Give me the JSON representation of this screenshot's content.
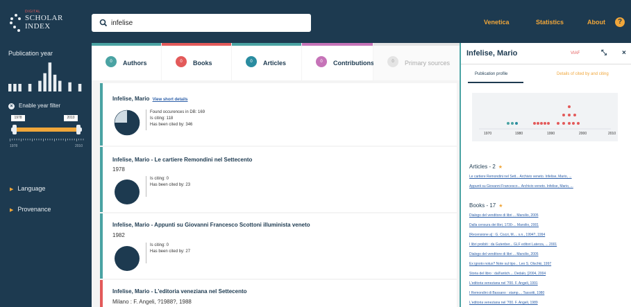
{
  "logo": {
    "pre": "DIGITAL",
    "line1": "SCHOLAR",
    "line2": "INDEX"
  },
  "search": {
    "value": "infelise"
  },
  "nav": [
    "Venetica",
    "Statistics",
    "About"
  ],
  "help": "?",
  "sidebar": {
    "title": "Publication year",
    "year_filter": "Enable year filter",
    "from": "1978",
    "to": "2010",
    "tick_start": "1978",
    "tick_end": "2010",
    "histogram": [
      0.25,
      0.25,
      0.25,
      0,
      0.25,
      0,
      0.35,
      0.6,
      0.95,
      0.55,
      0.35,
      0,
      0.3,
      0,
      0.25
    ],
    "facets": [
      "Language",
      "Provenance"
    ]
  },
  "tabs": [
    {
      "count": "0",
      "label": "Authors",
      "color": "#4aa3a3",
      "badge": "#4aa3a3"
    },
    {
      "count": "0",
      "label": "Books",
      "color": "#e35a5a",
      "badge": "#e35a5a"
    },
    {
      "count": "0",
      "label": "Articles",
      "color": "#4aa3a3",
      "badge": "#2a8ca0"
    },
    {
      "count": "0",
      "label": "Contributions",
      "color": "#c673b8",
      "badge": "#c673b8"
    },
    {
      "count": "0",
      "label": "Primary sources",
      "color": "#e4e4e4",
      "badge": "#e4e4e4"
    }
  ],
  "results": [
    {
      "title": "Infelise, Mario",
      "link": "View short details",
      "subtitle": "",
      "info": [
        "Found occurences in DB: 169",
        "Is citing: 118",
        "Has been cited by: 346"
      ],
      "citing_fraction": 0.75
    },
    {
      "title": "Infelise, Mario - Le cartiere Remondini nel Settecento",
      "link": "",
      "subtitle": "1978",
      "info": [
        "Is citing: 0",
        "Has been cited by: 23"
      ],
      "citing_fraction": 1
    },
    {
      "title": "Infelise, Mario - Appunti su Giovanni Francesco Scottoni illuminista veneto",
      "link": "",
      "subtitle": "1982",
      "info": [
        "Is citing: 0",
        "Has been cited by: 27"
      ],
      "citing_fraction": 1
    },
    {
      "title": "Infelise, Mario - L'editoria veneziana nel Settecento",
      "link": "",
      "subtitle": "Milano : F. Angeli, ?1988?, 1988",
      "info": [],
      "citing_fraction": 1
    }
  ],
  "panel": {
    "name": "Infelise, Mario",
    "viaf": "VIAF",
    "tab_profile": "Publication profile",
    "tab_details": "Details of cited by and citing",
    "axis": [
      "1970",
      "1980",
      "1990",
      "2000",
      "2010"
    ],
    "articles_header": "Articles - 2",
    "articles": [
      "Le cartiere Remondini nel Sett... Archivio veneto. Infelise, Mario, ...",
      "Appunti su Giovanni Francesco... Archivio veneto. Infelise, Mario, ..."
    ],
    "books_header": "Books - 17",
    "books": [
      "Dialogo del venditore di libri ... Marsilio, 2005",
      "Dalla censura dei libri, 1730-... Marsilio, 2001",
      "[Recensione a] : G. Cozzi, M.... s.n., 1994?, 1994",
      "I libri proibiti : da Gutenber... GLF editori Laterza, ... 2001",
      "Dialogo del venditore di libri ... Marsilio, 2005",
      "Ex ignoto notus? Note sul tipo... Leo S. Olschki, 1997",
      "Storia del libro : dall'antich.... Dedalo, [2004, 2004",
      "L'editoria veneziana nel '700. F. Angeli, 1991",
      "I Remondini di Bassano : stamp.... Tassotti, 1980",
      "L'editoria veneziana nel '700. F. Angeli, 1989"
    ]
  },
  "colors": {
    "dark": "#1d3a50",
    "accent": "#f0a63a",
    "teal": "#4aa3a3",
    "red": "#e35a5a"
  }
}
